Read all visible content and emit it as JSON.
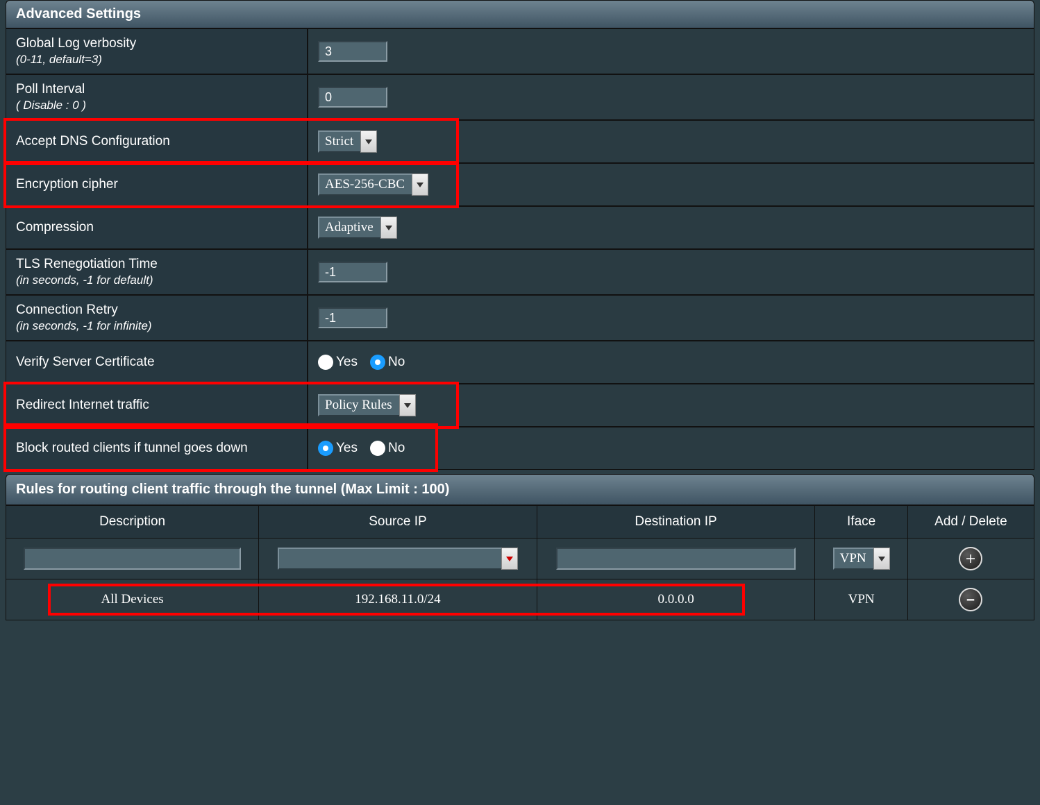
{
  "section_advanced_title": "Advanced Settings",
  "rows": {
    "log_verbosity": {
      "label": "Global Log verbosity",
      "sub": "(0-11, default=3)",
      "value": "3"
    },
    "poll_interval": {
      "label": "Poll Interval",
      "sub": "( Disable : 0 )",
      "value": "0"
    },
    "accept_dns": {
      "label": "Accept DNS Configuration",
      "value": "Strict"
    },
    "enc_cipher": {
      "label": "Encryption cipher",
      "value": "AES-256-CBC"
    },
    "compression": {
      "label": "Compression",
      "value": "Adaptive"
    },
    "tls_reneg": {
      "label": "TLS Renegotiation Time",
      "sub": "(in seconds, -1 for default)",
      "value": "-1"
    },
    "conn_retry": {
      "label": "Connection Retry",
      "sub": "(in seconds, -1 for infinite)",
      "value": "-1"
    },
    "verify_cert": {
      "label": "Verify Server Certificate",
      "yes": "Yes",
      "no": "No",
      "selected": "No"
    },
    "redirect": {
      "label": "Redirect Internet traffic",
      "value": "Policy Rules"
    },
    "block_routed": {
      "label": "Block routed clients if tunnel goes down",
      "yes": "Yes",
      "no": "No",
      "selected": "Yes"
    }
  },
  "rules_section_title": "Rules for routing client traffic through the tunnel (Max Limit : 100)",
  "rules_headers": {
    "description": "Description",
    "source_ip": "Source IP",
    "dest_ip": "Destination IP",
    "iface": "Iface",
    "add_delete": "Add / Delete"
  },
  "rules_input": {
    "description": "",
    "source_ip": "",
    "dest_ip": "",
    "iface": "VPN"
  },
  "rules_data": [
    {
      "description": "All Devices",
      "source_ip": "192.168.11.0/24",
      "dest_ip": "0.0.0.0",
      "iface": "VPN"
    }
  ]
}
